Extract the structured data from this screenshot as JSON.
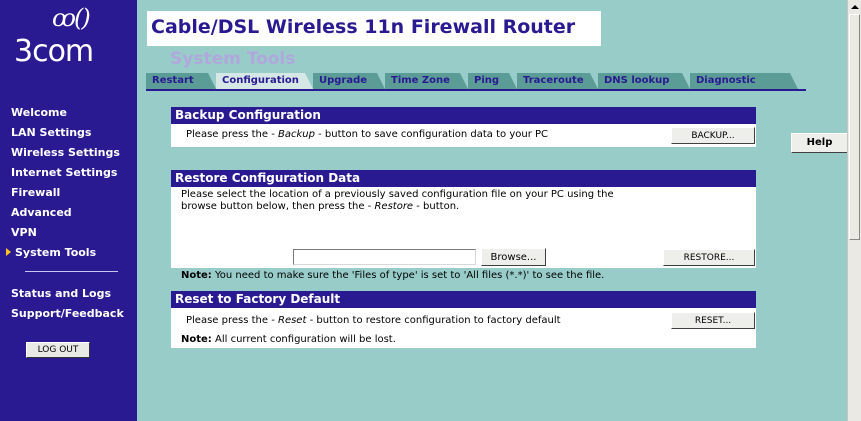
{
  "brand": {
    "mark": "ꝏ()",
    "name": "3com"
  },
  "header": {
    "title": "Cable/DSL Wireless 11n Firewall Router",
    "subtitle": "System Tools"
  },
  "sidebar": {
    "items": [
      {
        "label": "Welcome"
      },
      {
        "label": "LAN Settings"
      },
      {
        "label": "Wireless Settings"
      },
      {
        "label": "Internet Settings"
      },
      {
        "label": "Firewall"
      },
      {
        "label": "Advanced"
      },
      {
        "label": "VPN"
      },
      {
        "label": "System Tools",
        "active": true
      }
    ],
    "items2": [
      {
        "label": "Status and Logs"
      },
      {
        "label": "Support/Feedback"
      }
    ],
    "logout_label": "LOG OUT"
  },
  "tabs": [
    {
      "label": "Restart"
    },
    {
      "label": "Configuration",
      "active": true
    },
    {
      "label": "Upgrade"
    },
    {
      "label": "Time Zone"
    },
    {
      "label": "Ping"
    },
    {
      "label": "Traceroute"
    },
    {
      "label": "DNS lookup"
    },
    {
      "label": "Diagnostic"
    }
  ],
  "help_label": "Help",
  "backup": {
    "title": "Backup Configuration",
    "text_pre": "Please press the - ",
    "text_em": "Backup",
    "text_post": " - button to save configuration data to your PC",
    "button": "BACKUP..."
  },
  "restore": {
    "title": "Restore Configuration Data",
    "line1": "Please select the location of a previously saved configuration file on your PC using the",
    "line2_pre": "browse button below, then press the - ",
    "line2_em": "Restore",
    "line2_post": " - button.",
    "file_value": "",
    "browse_button": "Browse...",
    "button": "RESTORE...",
    "note_label": "Note:",
    "note_text": " You need to make sure the 'Files of type' is set to 'All files (*.*)' to see the file."
  },
  "reset": {
    "title": "Reset to Factory Default",
    "text_pre": "Please press the - ",
    "text_em": "Reset",
    "text_post": " - button to restore configuration to factory default",
    "button": "RESET...",
    "note_label": "Note:",
    "note_text": " All current configuration will be lost."
  },
  "colors": {
    "sidebar": "#2a1a92",
    "background": "#98ccc8",
    "tab": "#5b9c97",
    "tab_active": "#d6e8e6",
    "accent_arrow": "#ffc21a"
  }
}
